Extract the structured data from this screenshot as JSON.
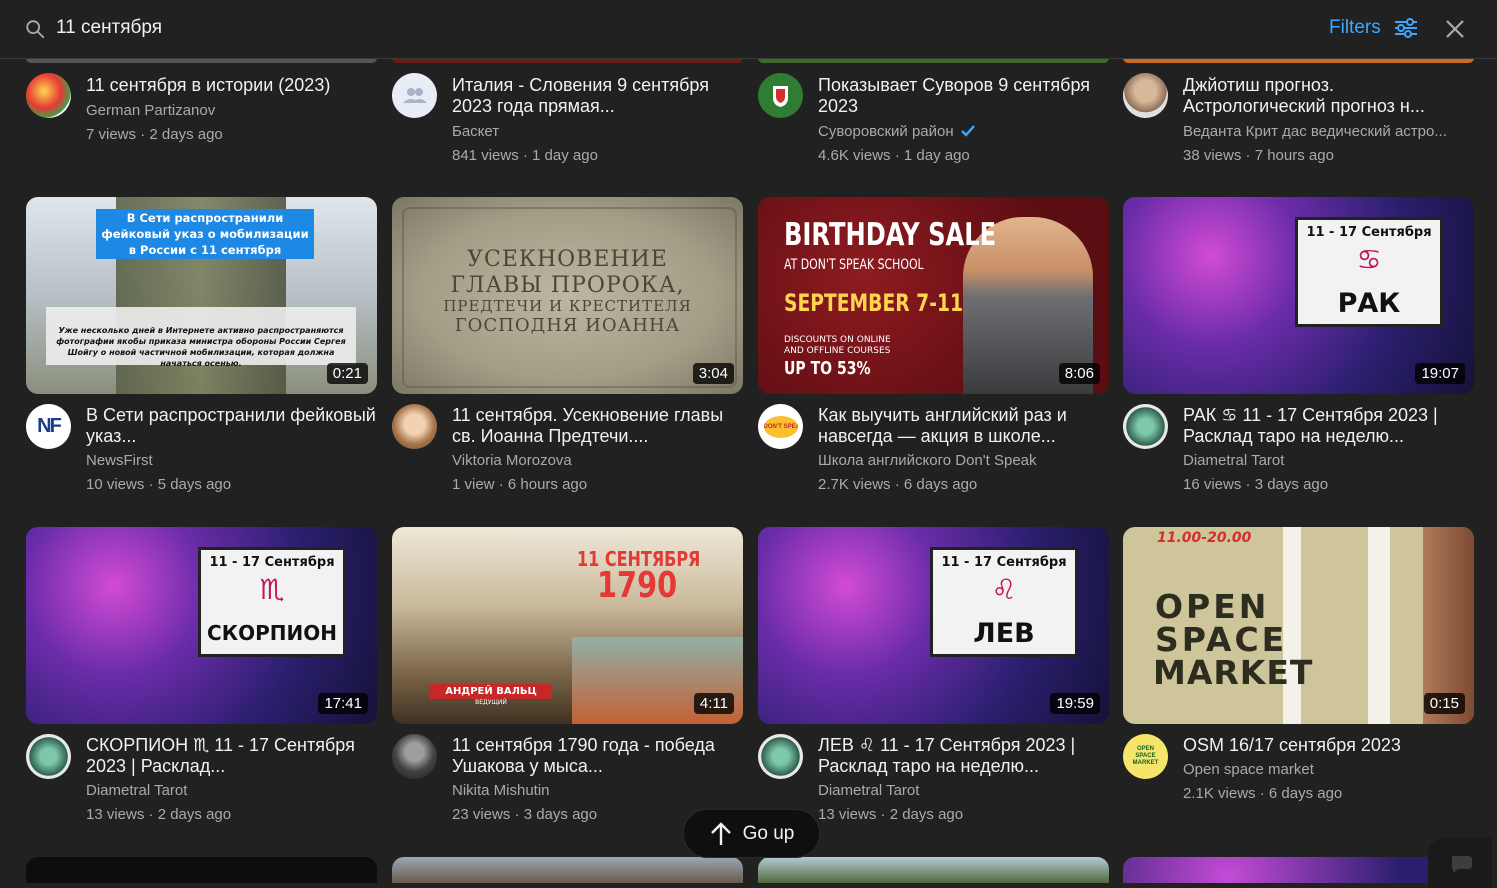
{
  "search": {
    "query": "11 сентября",
    "filters_label": "Filters"
  },
  "go_up_label": "Go up",
  "colors": {
    "background": "#212121",
    "accent": "#3ea6ff",
    "secondary_text": "#aaaaaa"
  },
  "row1": [
    {
      "title": "11 сентября в истории (2023)",
      "channel": "German Partizanov",
      "views": "7 views",
      "age": "2 days ago"
    },
    {
      "title": "Италия - Словения 9 сентября 2023 года прямая...",
      "channel": "Баскет",
      "views": "841 views",
      "age": "1 day ago"
    },
    {
      "title": "Показывает Суворов 9 сентября 2023",
      "channel": "Суворовский район",
      "views": "4.6K views",
      "age": "1 day ago",
      "verified": true
    },
    {
      "title": "Джйотиш прогноз. Астрологический прогноз н...",
      "channel": "Веданта Крит дас ведический астро...",
      "views": "38 views",
      "age": "7 hours ago"
    }
  ],
  "row2": [
    {
      "title": "В Сети распространили фейковый указ...",
      "channel": "NewsFirst",
      "views": "10 views",
      "age": "5 days ago",
      "duration": "0:21",
      "thumb_caption": "В Сети распространили фейковый указ о мобилизации в России с 11 сентября",
      "thumb_sub": "Уже несколько дней в Интернете активно распространяются фотографии якобы приказа министра обороны России Сергея Шойгу о новой частичной мобилизации, которая должна начаться осенью.",
      "avatar_text": "NF"
    },
    {
      "title": "11 сентября. Усекновение главы св. Иоанна Предтечи....",
      "channel": "Viktoria Morozova",
      "views": "1 view",
      "age": "6 hours ago",
      "duration": "3:04",
      "thumb_line1": "УСЕКНОВЕНИЕ",
      "thumb_line2": "ГЛАВЫ ПРОРОКА,",
      "thumb_line3": "ПРЕДТЕЧИ И КРЕСТИТЕЛЯ",
      "thumb_line4": "ГОСПОДНЯ ИОАННА"
    },
    {
      "title": "Как выучить английский раз и навсегда — акция в школе...",
      "channel": "Школа английского Don't Speak",
      "views": "2.7K views",
      "age": "6 days ago",
      "duration": "8:06",
      "thumb_line1": "BIRTHDAY SALE",
      "thumb_line2": "AT DON'T SPEAK SCHOOL",
      "thumb_line3": "SEPTEMBER 7-11",
      "thumb_line4": "DISCOUNTS ON ONLINE",
      "thumb_line5": "AND OFFLINE COURSES",
      "thumb_line6": "UP TO 53%",
      "avatar_text": "DON'T SPEAK"
    },
    {
      "title": "РАК ♋ 11 - 17 Сентября 2023 | Расклад таро на неделю...",
      "channel": "Diametral Tarot",
      "views": "16 views",
      "age": "3 days ago",
      "duration": "19:07",
      "thumb_dates": "11 - 17 Сентября",
      "thumb_sign": "♋",
      "thumb_name": "РАК"
    }
  ],
  "row3": [
    {
      "title": "СКОРПИОН ♏ 11 - 17 Сентября 2023 | Расклад...",
      "channel": "Diametral Tarot",
      "views": "13 views",
      "age": "2 days ago",
      "duration": "17:41",
      "thumb_dates": "11 - 17 Сентября",
      "thumb_sign": "♏",
      "thumb_name": "СКОРПИОН"
    },
    {
      "title": "11 сентября 1790 года - победа Ушакова у мыса...",
      "channel": "Nikita Mishutin",
      "views": "23 views",
      "age": "3 days ago",
      "duration": "4:11",
      "thumb_line1": "11 СЕНТЯБРЯ",
      "thumb_line2": "1790",
      "thumb_line3": "АНДРЕЙ ВАЛЬЦ",
      "thumb_line4": "ВЕДУЩИЙ"
    },
    {
      "title": "ЛЕВ ♌ 11 - 17 Сентября 2023 | Расклад таро на неделю...",
      "channel": "Diametral Tarot",
      "views": "13 views",
      "age": "2 days ago",
      "duration": "19:59",
      "thumb_dates": "11 - 17 Сентября",
      "thumb_sign": "♌",
      "thumb_name": "ЛЕВ"
    },
    {
      "title": "OSM 16/17 сентября 2023",
      "channel": "Open space market",
      "views": "2.1K views",
      "age": "6 days ago",
      "duration": "0:15",
      "thumb_time": "11.00-20.00",
      "thumb_line1": "OPEN",
      "thumb_line2": "SPACE",
      "thumb_line3": "MARKET",
      "avatar_text": "OPEN SPACE MARKET"
    }
  ]
}
